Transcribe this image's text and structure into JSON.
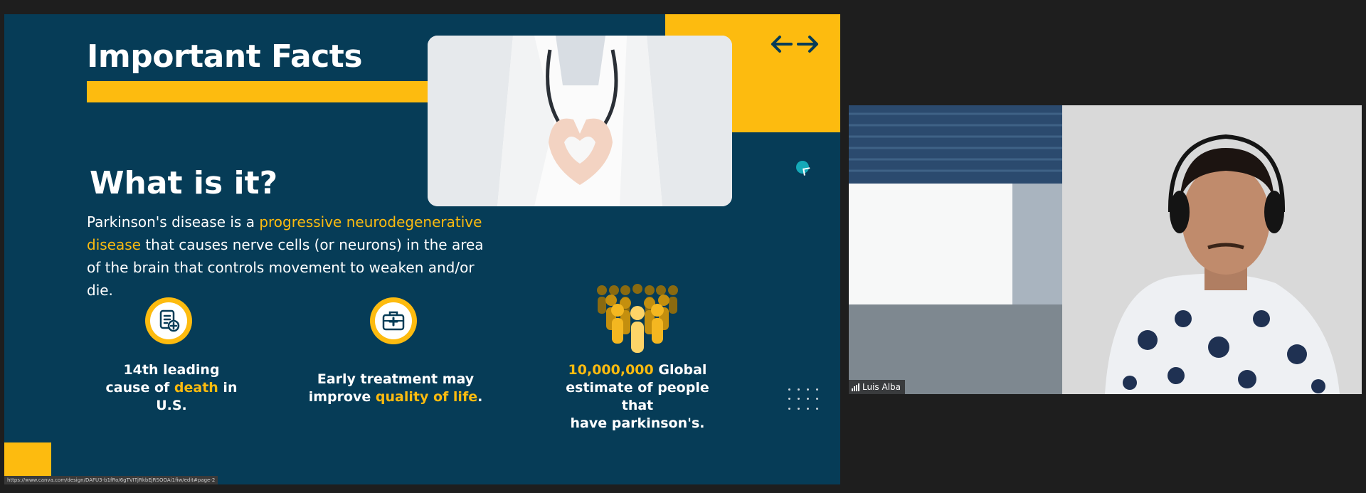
{
  "slide": {
    "title": "Important Facts",
    "subtitle": "What is it?",
    "paragraph": {
      "part1": "Parkinson's disease is a ",
      "highlight": "progressive neurodegenerative disease",
      "part2": " that causes nerve cells (or neurons) in the area of the brain that controls movement to weaken and/or die."
    },
    "facts": [
      {
        "line_a": "14th leading",
        "line_b_pre": "cause of ",
        "line_b_hl": "death",
        "line_b_post": " in",
        "line_c": "U.S."
      },
      {
        "line_a": "Early treatment may",
        "line_b_pre": "improve ",
        "line_b_hl": "quality of life",
        "line_b_post": "."
      },
      {
        "hl": "10,000,000",
        "line_a_post": " Global",
        "line_b": "estimate of people that",
        "line_c": "have parkinson's."
      }
    ],
    "icons": {
      "fact1": "medical-document-icon",
      "fact2": "first-aid-kit-icon",
      "fact3": "people-group-icon",
      "navigation": "left-right-arrows-icon"
    },
    "colors": {
      "background": "#063c57",
      "accent": "#fdbb0f",
      "cursor": "#15a9b8"
    }
  },
  "status_bar": {
    "url": "https://www.canva.com/design/DAFU3-b1fRo/6gTVITjRkbEjRSOOAi1fiw/edit#page-2"
  },
  "participant": {
    "name": "Luis Alba"
  }
}
